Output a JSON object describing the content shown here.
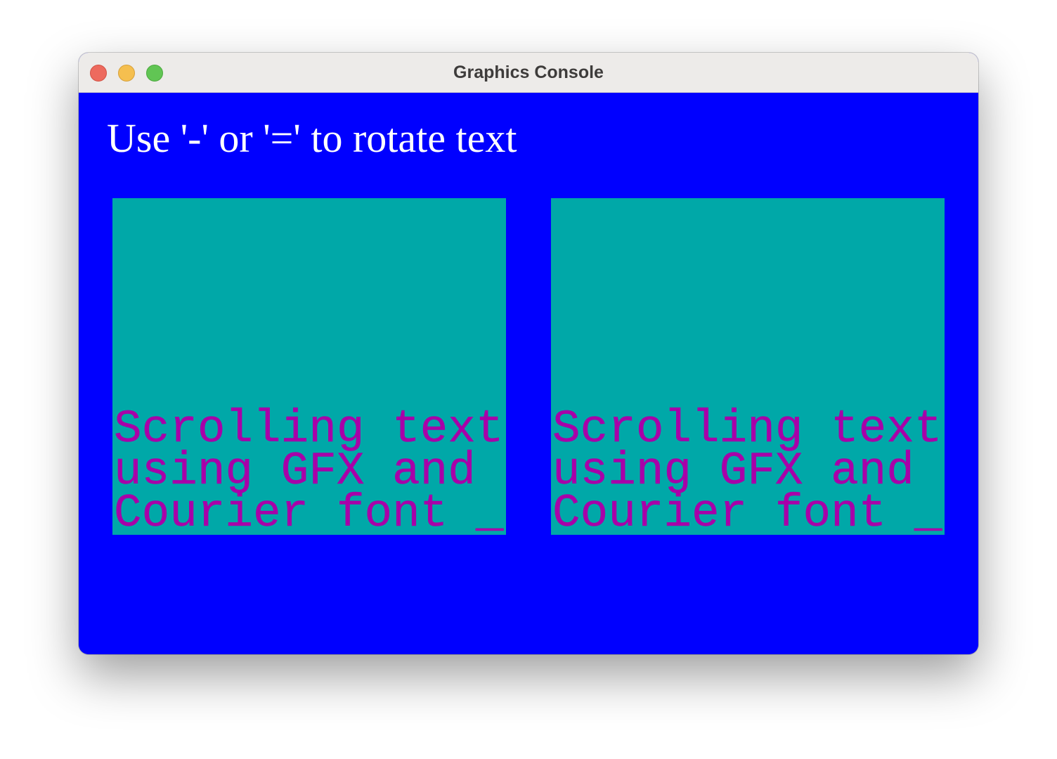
{
  "window": {
    "title": "Graphics Console"
  },
  "canvas": {
    "instruction": "Use '-' or '=' to rotate text",
    "background_color": "#0000ff",
    "panel_color": "#00a8a8",
    "text_color": "#a800a8"
  },
  "panels": [
    {
      "lines": [
        "Scrolling text",
        "using GFX and",
        "Courier font _"
      ]
    },
    {
      "lines": [
        "Scrolling text",
        "using GFX and",
        "Courier font _"
      ]
    }
  ]
}
